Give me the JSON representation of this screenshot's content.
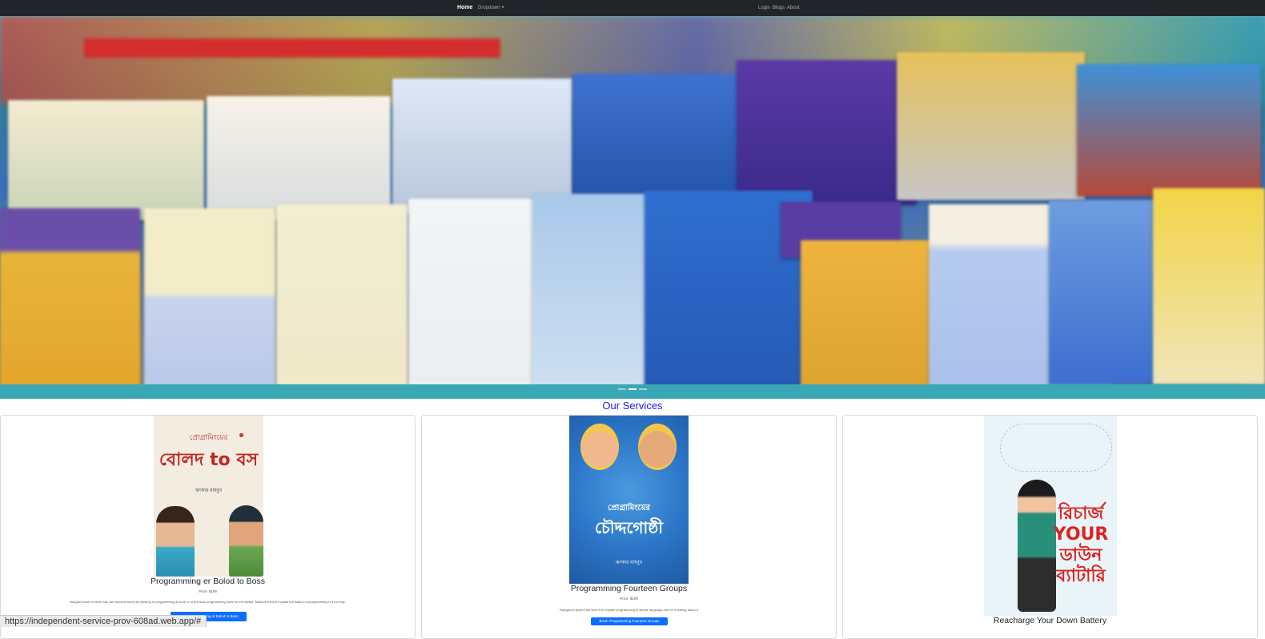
{
  "navbar": {
    "home": "Home",
    "dropdown": "Dropdown",
    "login": "Login",
    "blogs": "Blogs",
    "about": "About"
  },
  "hero": {
    "slides": 3,
    "active_slide": 2
  },
  "services": {
    "title": "Our Services",
    "cards": [
      {
        "title": "Programming er Bolod to Boss",
        "price": "Price: $199",
        "description": "Bangla's book on how bulb can become boom by sticking to programming at work. In a previous programming book for the rabbur, Mahbub tried to explain the basics of programming in a fun way.",
        "button": "Book: Programming er Bolod to Boss",
        "cover_text_top": "প্রোগ্রামিংয়ের",
        "cover_text_main": "বোলদ to বস",
        "cover_author": "ঝংকার মাহবুব"
      },
      {
        "title": "Programming Fourteen Groups",
        "price": "Price: $200",
        "description": "Banglian's project the time is to explain programming in simple language and he is writing about it",
        "button": "Book: Programming Fourteen Groups",
        "cover_text_top": "প্রোগ্রামিংয়ের",
        "cover_text_main": "চৌদ্দগোষ্ঠী",
        "cover_author": "ঝংকার মাহবুব"
      },
      {
        "title": "Reacharge Your Down Battery",
        "cover_text_main": "রিচার্জ YOUR ডাউন ব্যাটারি"
      }
    ]
  },
  "status_bar": {
    "url": "https://independent-service-prov-608ad.web.app/#"
  },
  "colors": {
    "navbar_bg": "#212529",
    "section_title": "#1a1aee",
    "button_bg": "#0d6efd"
  }
}
